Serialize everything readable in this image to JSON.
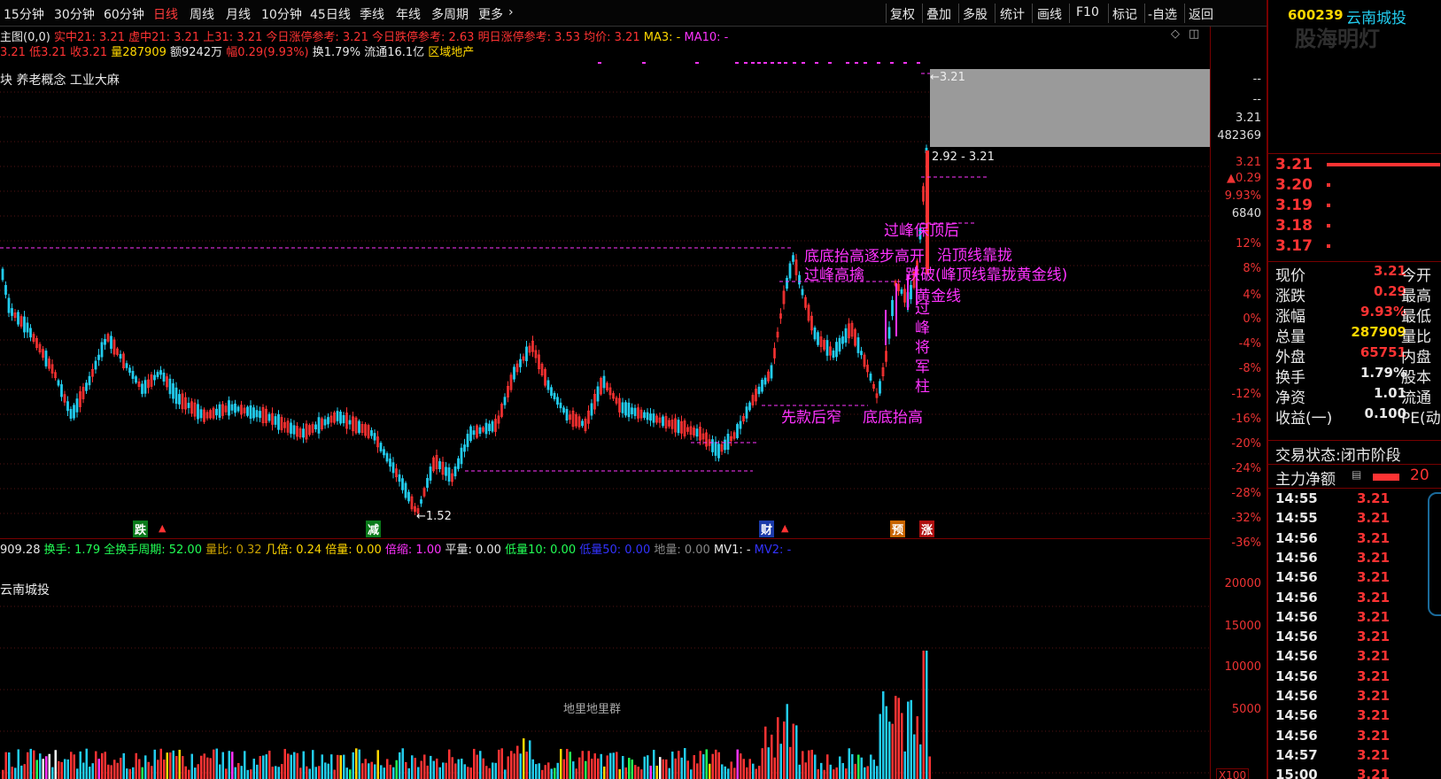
{
  "toolbar": {
    "periods": [
      "15分钟",
      "30分钟",
      "60分钟",
      "日线",
      "周线",
      "月线",
      "10分钟",
      "45日线",
      "季线",
      "年线",
      "多周期",
      "更多"
    ],
    "active_period": "日线",
    "more_chevron": "›",
    "right_buttons": [
      "复权",
      "叠加",
      "多股",
      "统计",
      "画线",
      "F10",
      "标记",
      "-自选",
      "返回"
    ]
  },
  "header": {
    "stock_code": "600239",
    "stock_name": "云南城投",
    "watermark": "股海明灯"
  },
  "info_row1": {
    "label": "主图(0,0)",
    "items": [
      {
        "text": "实中21: 3.21",
        "color": "#ff3333"
      },
      {
        "text": "虚中21: 3.21",
        "color": "#ff3333"
      },
      {
        "text": "上31: 3.21",
        "color": "#ff3333"
      },
      {
        "text": "今日涨停参考: 3.21",
        "color": "#ff3333"
      },
      {
        "text": "今日跌停参考: 2.63",
        "color": "#ff3333"
      },
      {
        "text": "明日涨停参考: 3.53",
        "color": "#ff3333"
      },
      {
        "text": "均价: 3.21",
        "color": "#ff3333"
      },
      {
        "text": "MA3: -",
        "color": "#ffd700"
      },
      {
        "text": "MA10: -",
        "color": "#ff33ff"
      }
    ]
  },
  "info_row2": {
    "items": [
      {
        "text": "3.21",
        "color": "#ff3333"
      },
      {
        "text": "低3.21",
        "color": "#ff3333"
      },
      {
        "text": "收3.21",
        "color": "#ff3333"
      },
      {
        "text": "量287909",
        "color": "#ffd700"
      },
      {
        "text": "额9242万",
        "color": "#e8e8e8"
      },
      {
        "text": "幅0.29(9.93%)",
        "color": "#ff3333"
      },
      {
        "text": "换1.79%",
        "color": "#e8e8e8"
      },
      {
        "text": "流通16.1亿",
        "color": "#e8e8e8"
      },
      {
        "text": "区域地产",
        "color": "#ffd700"
      }
    ]
  },
  "sector_row": {
    "text": "块    养老概念 工业大麻"
  },
  "price_axis": [
    {
      "text": "--",
      "white": true
    },
    {
      "text": "--",
      "white": true
    },
    {
      "text": "3.21",
      "white": true
    },
    {
      "text": "482369",
      "white": true
    },
    {
      "text": "3.21",
      "white": false
    },
    {
      "text": "▲0.29",
      "white": false
    },
    {
      "text": "9.93%",
      "white": false
    },
    {
      "text": "6840",
      "white": true
    },
    {
      "text": "12%",
      "white": false
    },
    {
      "text": "8%",
      "white": false
    },
    {
      "text": "4%",
      "white": false
    },
    {
      "text": "0%",
      "white": false
    },
    {
      "text": "-4%",
      "white": false
    },
    {
      "text": "-8%",
      "white": false
    },
    {
      "text": "-12%",
      "white": false
    },
    {
      "text": "-16%",
      "white": false
    },
    {
      "text": "-20%",
      "white": false
    },
    {
      "text": "-24%",
      "white": false
    },
    {
      "text": "-28%",
      "white": false
    },
    {
      "text": "-32%",
      "white": false
    },
    {
      "text": "-36%",
      "white": false
    }
  ],
  "volume_axis": [
    "20000",
    "15000",
    "10000",
    "5000"
  ],
  "volume_axis_unit": "X100",
  "annotations": {
    "high_label": "←3.21",
    "low_label": "←1.52",
    "range_label": "2.92 - 3.21",
    "a1": "过峰保顶后",
    "a2": "底底抬高逐步高开",
    "a3": "过峰高擒",
    "a4": "过峰将军柱",
    "a5": "黄金线",
    "a6": "沿顶线靠拢",
    "a7": "跌破(峰顶线靠拢黄金线)",
    "a8": "先款后窄",
    "a9": "底底抬高",
    "vertical": [
      "过",
      "峰",
      "将",
      "军",
      "柱"
    ]
  },
  "bottom_tags": [
    {
      "text": "跌",
      "bg": "#0a7a1a",
      "color": "#fff"
    },
    {
      "text": "减",
      "bg": "#0a7a1a",
      "color": "#fff"
    },
    {
      "text": "财",
      "bg": "#1a3aaa",
      "color": "#fff"
    },
    {
      "text": "预",
      "bg": "#c86400",
      "color": "#fff"
    },
    {
      "text": "涨",
      "bg": "#b01010",
      "color": "#fff"
    }
  ],
  "volume_info": {
    "prefix": "909.28",
    "items": [
      {
        "text": "换手: 1.79",
        "color": "#22ff55"
      },
      {
        "text": "全换手周期: 52.00",
        "color": "#22ff55"
      },
      {
        "text": "量比: 0.32",
        "color": "#c8a000"
      },
      {
        "text": "几倍: 0.24",
        "color": "#ffd700"
      },
      {
        "text": "倍量: 0.00",
        "color": "#ffd700"
      },
      {
        "text": "倍缩: 1.00",
        "color": "#ff33ff"
      },
      {
        "text": "平量: 0.00",
        "color": "#e8e8e8"
      },
      {
        "text": "低量10: 0.00",
        "color": "#22ff55"
      },
      {
        "text": "低量50: 0.00",
        "color": "#3333ff"
      },
      {
        "text": "地量: 0.00",
        "color": "#888888"
      },
      {
        "text": "MV1: -",
        "color": "#e8e8e8"
      },
      {
        "text": "MV2: -",
        "color": "#3333ff"
      }
    ],
    "stock_name_short": "云南城投",
    "ground_label": "地里地里群"
  },
  "orderbook": [
    {
      "price": "3.21",
      "bar": 1.0
    },
    {
      "price": "3.20",
      "bar": 0.02
    },
    {
      "price": "3.19",
      "bar": 0.02
    },
    {
      "price": "3.18",
      "bar": 0.02
    },
    {
      "price": "3.17",
      "bar": 0.02
    }
  ],
  "quote": [
    {
      "l": "现价",
      "v": "3.21",
      "vc": "#ff3333",
      "r": "今开"
    },
    {
      "l": "涨跌",
      "v": "0.29",
      "vc": "#ff3333",
      "r": "最高"
    },
    {
      "l": "涨幅",
      "v": "9.93%",
      "vc": "#ff3333",
      "r": "最低"
    },
    {
      "l": "总量",
      "v": "287909",
      "vc": "#ffd700",
      "r": "量比"
    },
    {
      "l": "外盘",
      "v": "65751",
      "vc": "#ff3333",
      "r": "内盘"
    },
    {
      "l": "换手",
      "v": "1.79%",
      "vc": "#e8e8e8",
      "r": "股本"
    },
    {
      "l": "净资",
      "v": "1.01",
      "vc": "#e8e8e8",
      "r": "流通"
    },
    {
      "l": "收益(一)",
      "v": "0.100",
      "vc": "#e8e8e8",
      "r": "PE(动"
    }
  ],
  "trade_status": {
    "label": "交易状态:",
    "value": "闭市阶段"
  },
  "main_net": {
    "label": "主力净额",
    "value": "20"
  },
  "ticks": [
    {
      "t": "14:55",
      "p": "3.21"
    },
    {
      "t": "14:55",
      "p": "3.21"
    },
    {
      "t": "14:56",
      "p": "3.21"
    },
    {
      "t": "14:56",
      "p": "3.21"
    },
    {
      "t": "14:56",
      "p": "3.21"
    },
    {
      "t": "14:56",
      "p": "3.21"
    },
    {
      "t": "14:56",
      "p": "3.21"
    },
    {
      "t": "14:56",
      "p": "3.21"
    },
    {
      "t": "14:56",
      "p": "3.21"
    },
    {
      "t": "14:56",
      "p": "3.21"
    },
    {
      "t": "14:56",
      "p": "3.21"
    },
    {
      "t": "14:56",
      "p": "3.21"
    },
    {
      "t": "14:56",
      "p": "3.21"
    },
    {
      "t": "14:57",
      "p": "3.21"
    },
    {
      "t": "15:00",
      "p": "3.21"
    }
  ],
  "colors": {
    "up": "#ff3333",
    "down": "#22ccee",
    "magenta": "#ff33ff",
    "yellow": "#ffd700"
  }
}
